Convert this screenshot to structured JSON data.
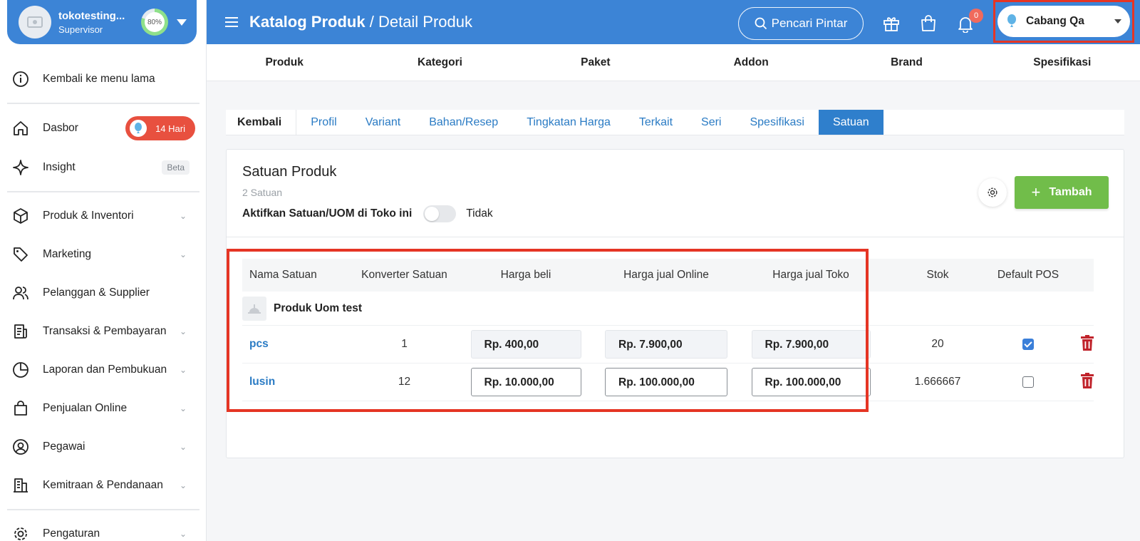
{
  "account": {
    "name": "tokotesting...",
    "role": "Supervisor",
    "progress": "80%"
  },
  "sidebar": {
    "items": [
      {
        "label": "Kembali ke menu lama"
      },
      {
        "label": "Dasbor",
        "badge": "14 Hari"
      },
      {
        "label": "Insight",
        "badge": "Beta"
      },
      {
        "label": "Produk & Inventori"
      },
      {
        "label": "Marketing"
      },
      {
        "label": "Pelanggan & Supplier"
      },
      {
        "label": "Transaksi & Pembayaran"
      },
      {
        "label": "Laporan dan Pembukuan"
      },
      {
        "label": "Penjualan Online"
      },
      {
        "label": "Pegawai"
      },
      {
        "label": "Kemitraan & Pendanaan"
      },
      {
        "label": "Pengaturan"
      }
    ]
  },
  "header": {
    "title": "Katalog Produk",
    "separator": "/",
    "subtitle": "Detail Produk",
    "smart_search": "Pencari Pintar",
    "notif_count": "0",
    "branch": "Cabang Qa"
  },
  "catalog_nav": [
    "Produk",
    "Kategori",
    "Paket",
    "Addon",
    "Brand",
    "Spesifikasi"
  ],
  "tabs": [
    "Kembali",
    "Profil",
    "Variant",
    "Bahan/Resep",
    "Tingkatan Harga",
    "Terkait",
    "Seri",
    "Spesifikasi",
    "Satuan"
  ],
  "panel": {
    "title": "Satuan Produk",
    "count": "2 Satuan",
    "toggle_label": "Aktifkan Satuan/UOM di Toko ini",
    "toggle_state": "Tidak",
    "add_button": "Tambah"
  },
  "table": {
    "headers": [
      "Nama Satuan",
      "Konverter Satuan",
      "Harga beli",
      "Harga jual Online",
      "Harga jual Toko",
      "Stok",
      "Default POS"
    ],
    "product_name": "Produk Uom test",
    "rows": [
      {
        "name": "pcs",
        "converter": "1",
        "buy": "Rp. 400,00",
        "online": "Rp. 7.900,00",
        "toko": "Rp. 7.900,00",
        "stok": "20",
        "default_pos": true
      },
      {
        "name": "lusin",
        "converter": "12",
        "buy": "Rp. 10.000,00",
        "online": "Rp. 100.000,00",
        "toko": "Rp. 100.000,00",
        "stok": "1.666667",
        "default_pos": false
      }
    ]
  },
  "colors": {
    "primary": "#3c84d6",
    "add_green": "#71bd4a",
    "highlight": "#e53524",
    "danger": "#c0232b"
  }
}
